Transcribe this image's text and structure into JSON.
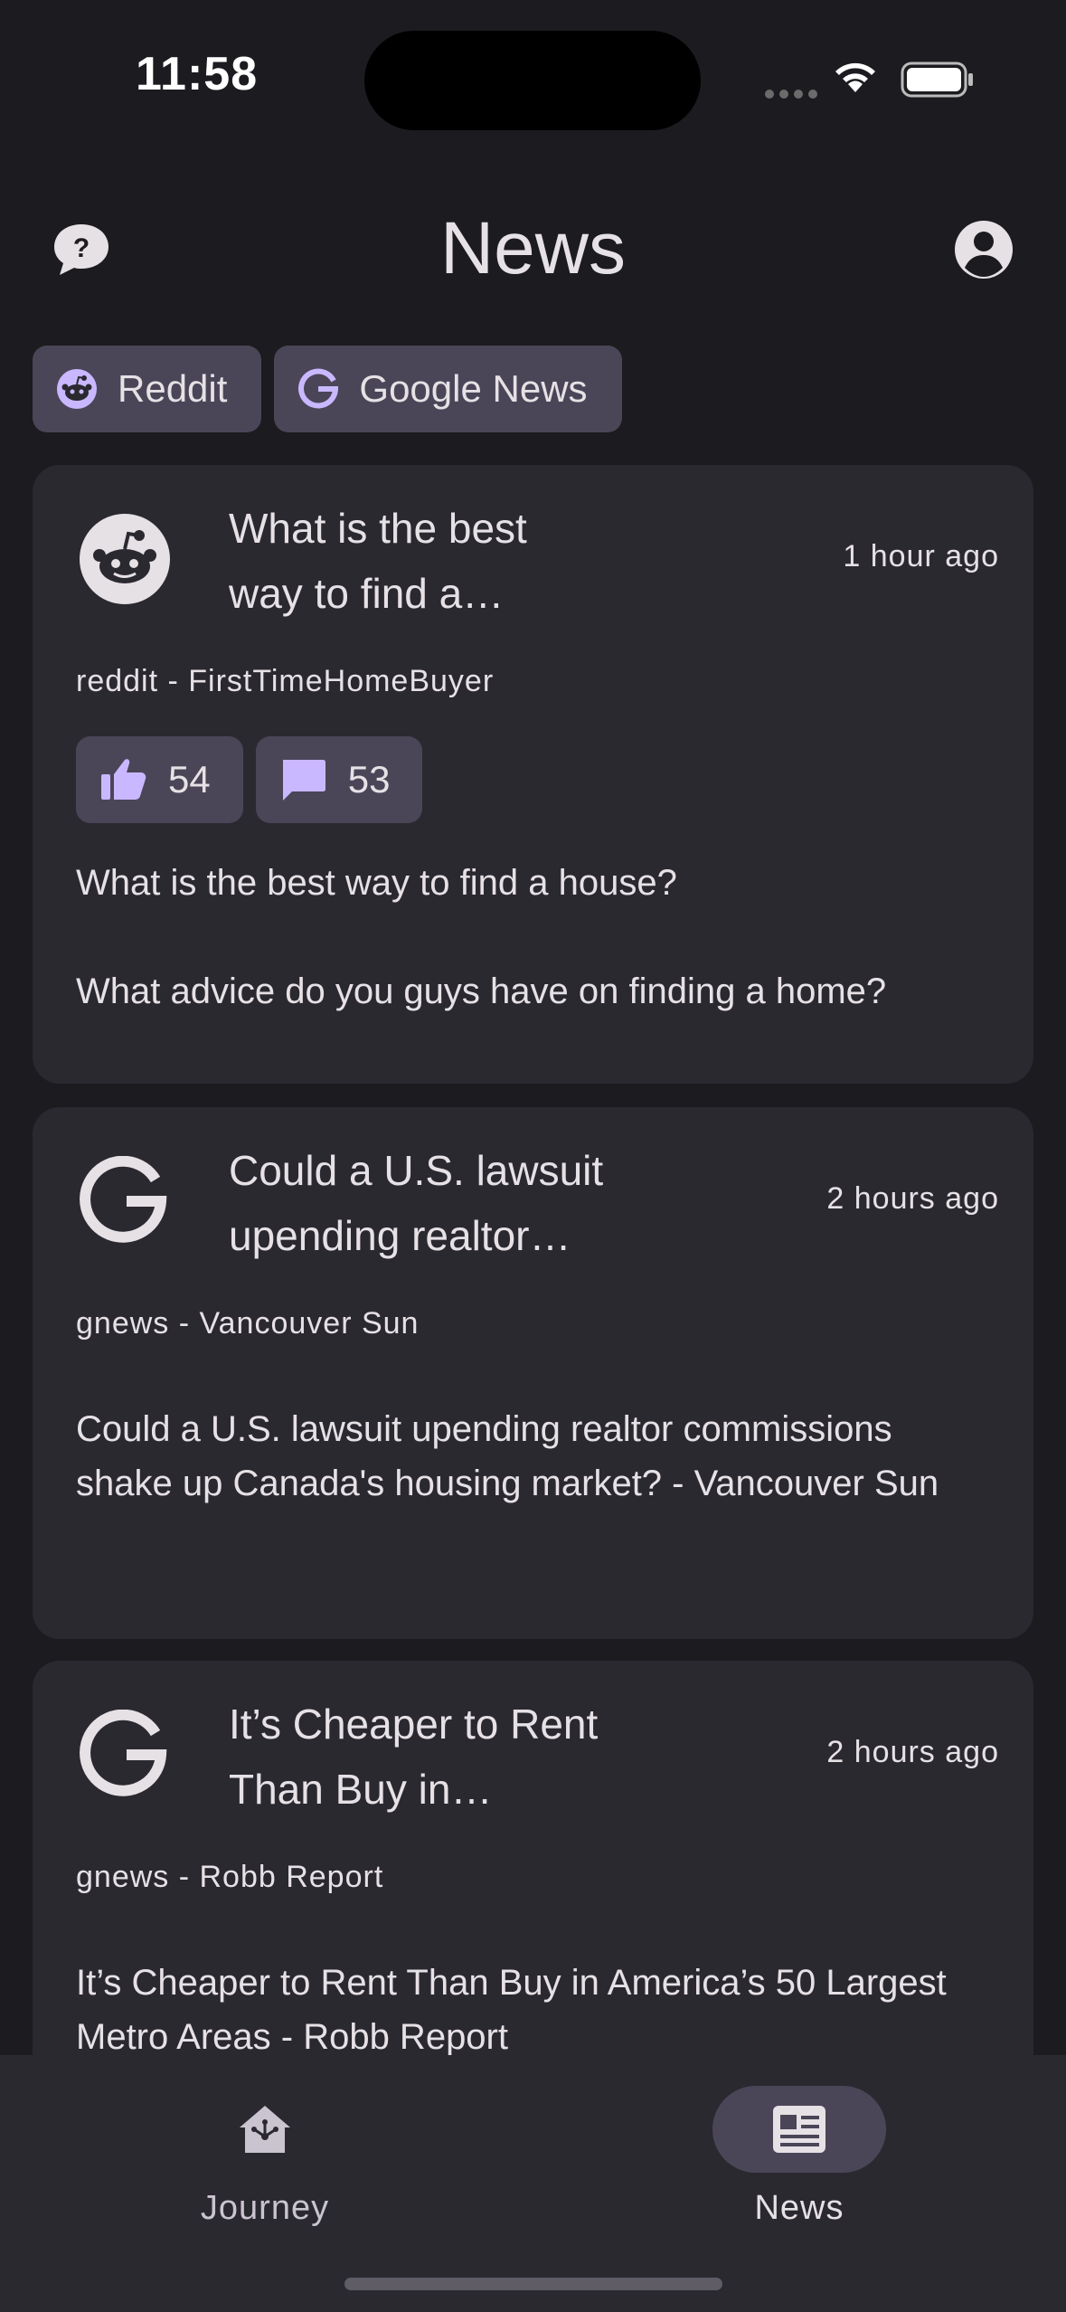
{
  "status_bar": {
    "time": "11:58"
  },
  "header": {
    "title": "News",
    "help_icon": "help-bubble-icon",
    "account_icon": "account-circle-icon"
  },
  "filters": [
    {
      "label": "Reddit",
      "icon": "reddit-icon"
    },
    {
      "label": "Google News",
      "icon": "google-icon"
    }
  ],
  "cards": [
    {
      "icon": "reddit-icon",
      "title": "What is the best way to find a house?",
      "time": "1 hour ago",
      "source": "reddit - FirstTimeHomeBuyer",
      "upvotes": "54",
      "comments": "53",
      "body_line1": "What is the best way to find a house?",
      "body_line2": "What advice do you guys have on finding a home?"
    },
    {
      "icon": "google-icon",
      "title": "Could a U.S. lawsuit upending realtor commissions shake up Canada's housing market? - Vancouver Sun",
      "time": "2 hours ago",
      "source": "gnews - Vancouver Sun",
      "body": "Could a U.S. lawsuit upending realtor commissions shake up Canada's housing market? - Vancouver Sun"
    },
    {
      "icon": "google-icon",
      "title": "It’s Cheaper to Rent Than Buy in America’s 50 Largest Metro Areas - Robb Report",
      "time": "2 hours ago",
      "source": "gnews - Robb Report",
      "body": "It’s Cheaper to Rent Than Buy in America’s 50 Largest Metro Areas - Robb Report"
    }
  ],
  "bottom_nav": [
    {
      "label": "Journey",
      "icon": "journey-home-icon",
      "active": false
    },
    {
      "label": "News",
      "icon": "newspaper-icon",
      "active": true
    }
  ],
  "colors": {
    "background": "#1c1b1f",
    "surface": "#2b2930",
    "chip": "#4a4658",
    "accent": "#c9b8ff"
  }
}
